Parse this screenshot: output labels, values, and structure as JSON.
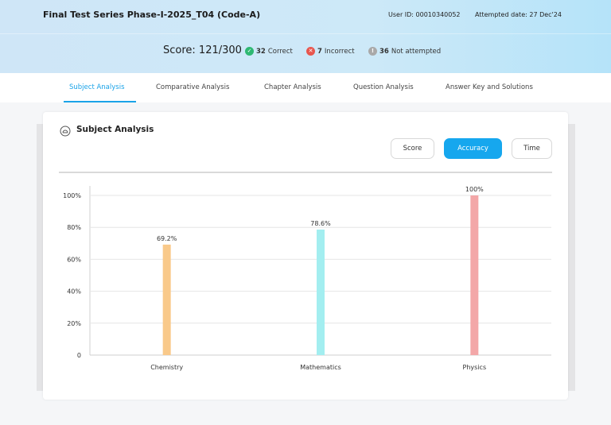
{
  "header": {
    "title": "Final Test Series Phase-I-2025_T04 (Code-A)",
    "user_id": "User ID: 00010340052",
    "attempted_date": "Attempted date: 27 Dec'24"
  },
  "summary": {
    "score": "Score: 121/300",
    "correct_count": "32",
    "correct_label": "Correct",
    "incorrect_count": "7",
    "incorrect_label": "Incorrect",
    "not_attempted_count": "36",
    "not_attempted_label": "Not attempted",
    "colors": {
      "correct": "#2eb872",
      "incorrect": "#e8564e",
      "not_attempted": "#a9a9a9"
    }
  },
  "tabs": [
    {
      "label": "Subject Analysis",
      "active": true
    },
    {
      "label": "Comparative Analysis",
      "active": false
    },
    {
      "label": "Chapter Analysis",
      "active": false
    },
    {
      "label": "Question Analysis",
      "active": false
    },
    {
      "label": "Answer Key and Solutions",
      "active": false
    }
  ],
  "card": {
    "title": "Subject Analysis",
    "icon": "gauge-icon",
    "toggle": {
      "score_label": "Score",
      "accuracy_label": "Accuracy",
      "time_label": "Time",
      "selected": "Accuracy"
    }
  },
  "accent_color": "#16a7ee",
  "chart_data": {
    "type": "bar",
    "title": "",
    "xlabel": "",
    "ylabel": "",
    "categories": [
      "Chemistry",
      "Mathematics",
      "Physics"
    ],
    "values": [
      69.2,
      78.6,
      100
    ],
    "value_labels": [
      "69.2%",
      "78.6%",
      "100%"
    ],
    "colors": [
      "#f9c98a",
      "#a3eef0",
      "#f3a7a8"
    ],
    "ylim": [
      0,
      100
    ],
    "yticks": [
      0,
      20,
      40,
      60,
      80,
      100
    ],
    "ytick_labels": [
      "0",
      "20%",
      "40%",
      "60%",
      "80%",
      "100%"
    ],
    "grid": true
  }
}
